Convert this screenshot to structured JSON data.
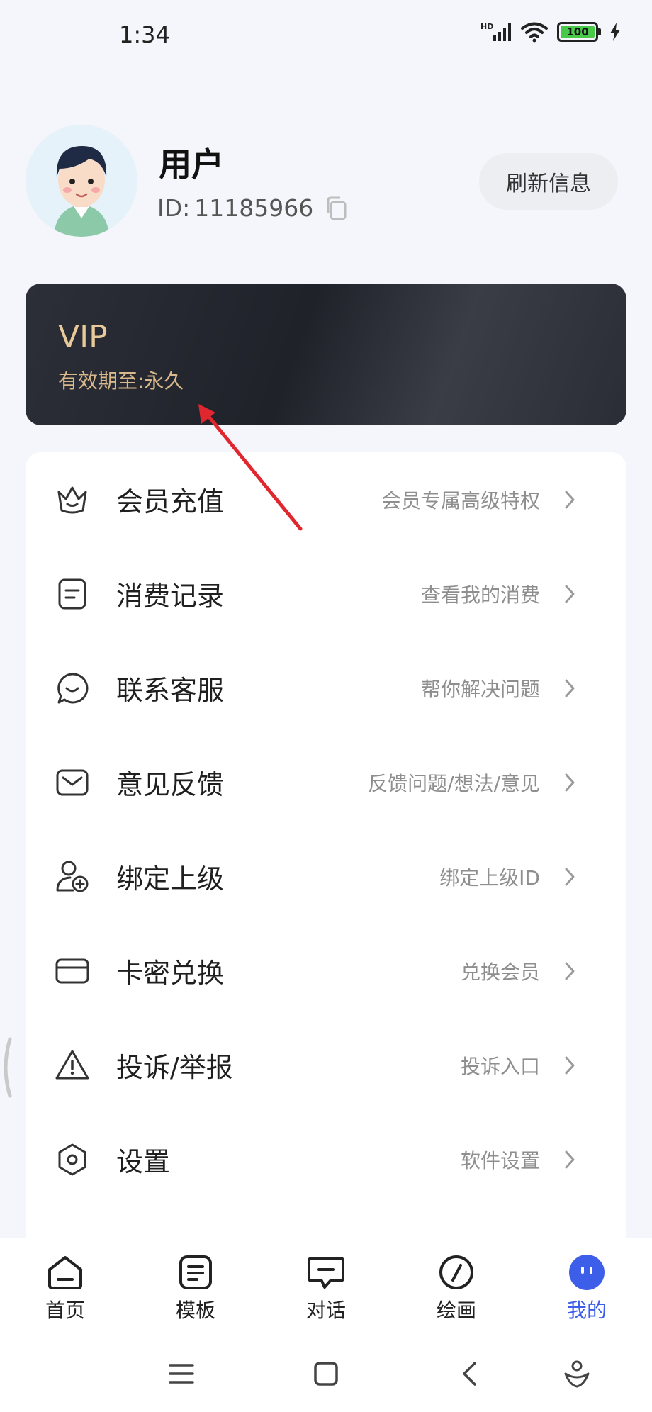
{
  "status_bar": {
    "time": "1:34",
    "network": "HD",
    "battery": "100"
  },
  "profile": {
    "name": "用户",
    "id_label": "ID:",
    "id_value": "11185966",
    "refresh_button": "刷新信息"
  },
  "vip": {
    "title": "VIP",
    "expiry": "有效期至:永久"
  },
  "menu": [
    {
      "label": "会员充值",
      "sub": "会员专属高级特权",
      "icon": "crown-icon"
    },
    {
      "label": "消费记录",
      "sub": "查看我的消费",
      "icon": "receipt-icon"
    },
    {
      "label": "联系客服",
      "sub": "帮你解决问题",
      "icon": "smile-chat-icon"
    },
    {
      "label": "意见反馈",
      "sub": "反馈问题/想法/意见",
      "icon": "mail-icon"
    },
    {
      "label": "绑定上级",
      "sub": "绑定上级ID",
      "icon": "user-add-icon"
    },
    {
      "label": "卡密兑换",
      "sub": "兑换会员",
      "icon": "card-icon"
    },
    {
      "label": "投诉/举报",
      "sub": "投诉入口",
      "icon": "warning-icon"
    },
    {
      "label": "设置",
      "sub": "软件设置",
      "icon": "settings-icon"
    }
  ],
  "bottom_nav": [
    {
      "label": "首页",
      "icon": "home-icon",
      "active": false
    },
    {
      "label": "模板",
      "icon": "template-icon",
      "active": false
    },
    {
      "label": "对话",
      "icon": "chat-icon",
      "active": false
    },
    {
      "label": "绘画",
      "icon": "compass-icon",
      "active": false
    },
    {
      "label": "我的",
      "icon": "profile-face-icon",
      "active": true
    }
  ],
  "colors": {
    "accent": "#3d5ee8",
    "vip_gold": "#e8c99a",
    "annotation": "#e0262f"
  }
}
